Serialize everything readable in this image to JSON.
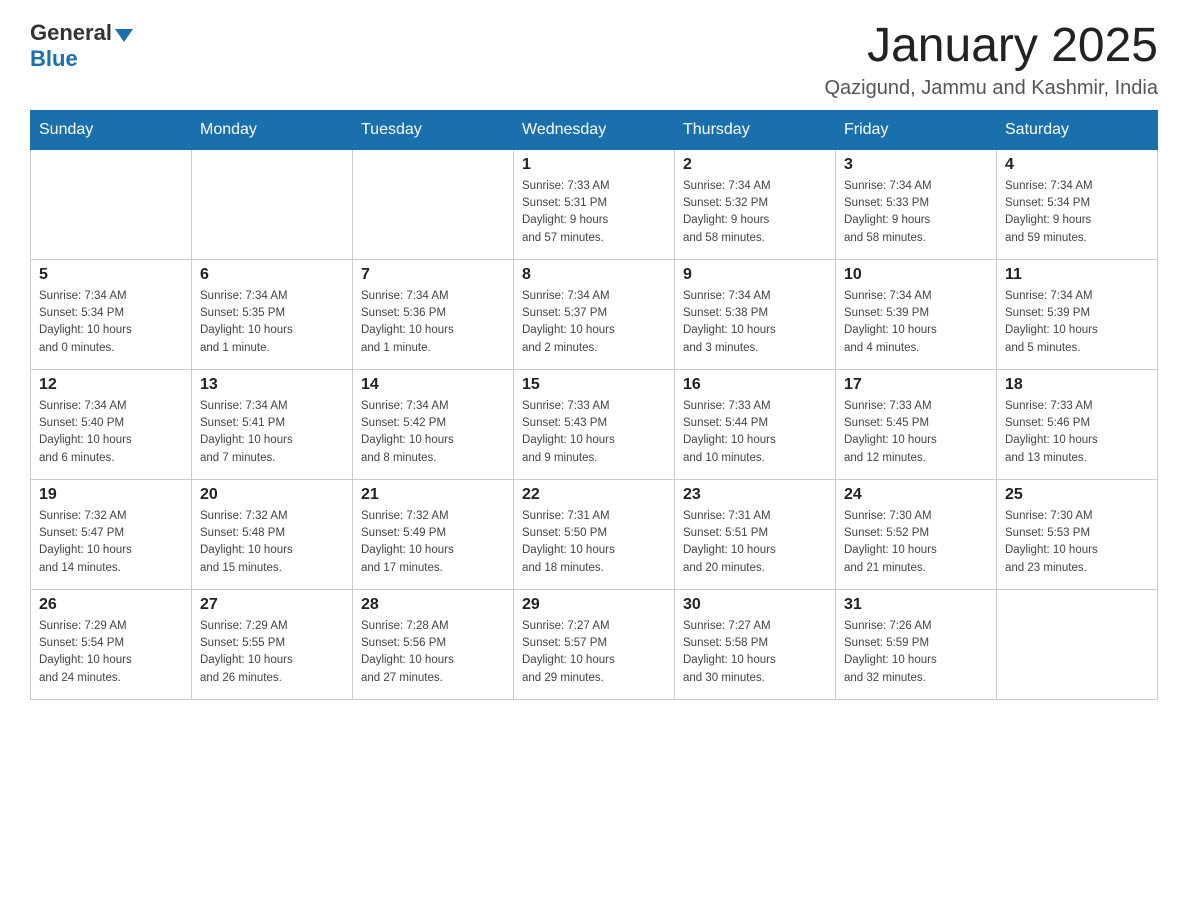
{
  "logo": {
    "general": "General",
    "blue": "Blue"
  },
  "title": {
    "month": "January 2025",
    "location": "Qazigund, Jammu and Kashmir, India"
  },
  "headers": [
    "Sunday",
    "Monday",
    "Tuesday",
    "Wednesday",
    "Thursday",
    "Friday",
    "Saturday"
  ],
  "weeks": [
    [
      {
        "day": "",
        "info": ""
      },
      {
        "day": "",
        "info": ""
      },
      {
        "day": "",
        "info": ""
      },
      {
        "day": "1",
        "info": "Sunrise: 7:33 AM\nSunset: 5:31 PM\nDaylight: 9 hours\nand 57 minutes."
      },
      {
        "day": "2",
        "info": "Sunrise: 7:34 AM\nSunset: 5:32 PM\nDaylight: 9 hours\nand 58 minutes."
      },
      {
        "day": "3",
        "info": "Sunrise: 7:34 AM\nSunset: 5:33 PM\nDaylight: 9 hours\nand 58 minutes."
      },
      {
        "day": "4",
        "info": "Sunrise: 7:34 AM\nSunset: 5:34 PM\nDaylight: 9 hours\nand 59 minutes."
      }
    ],
    [
      {
        "day": "5",
        "info": "Sunrise: 7:34 AM\nSunset: 5:34 PM\nDaylight: 10 hours\nand 0 minutes."
      },
      {
        "day": "6",
        "info": "Sunrise: 7:34 AM\nSunset: 5:35 PM\nDaylight: 10 hours\nand 1 minute."
      },
      {
        "day": "7",
        "info": "Sunrise: 7:34 AM\nSunset: 5:36 PM\nDaylight: 10 hours\nand 1 minute."
      },
      {
        "day": "8",
        "info": "Sunrise: 7:34 AM\nSunset: 5:37 PM\nDaylight: 10 hours\nand 2 minutes."
      },
      {
        "day": "9",
        "info": "Sunrise: 7:34 AM\nSunset: 5:38 PM\nDaylight: 10 hours\nand 3 minutes."
      },
      {
        "day": "10",
        "info": "Sunrise: 7:34 AM\nSunset: 5:39 PM\nDaylight: 10 hours\nand 4 minutes."
      },
      {
        "day": "11",
        "info": "Sunrise: 7:34 AM\nSunset: 5:39 PM\nDaylight: 10 hours\nand 5 minutes."
      }
    ],
    [
      {
        "day": "12",
        "info": "Sunrise: 7:34 AM\nSunset: 5:40 PM\nDaylight: 10 hours\nand 6 minutes."
      },
      {
        "day": "13",
        "info": "Sunrise: 7:34 AM\nSunset: 5:41 PM\nDaylight: 10 hours\nand 7 minutes."
      },
      {
        "day": "14",
        "info": "Sunrise: 7:34 AM\nSunset: 5:42 PM\nDaylight: 10 hours\nand 8 minutes."
      },
      {
        "day": "15",
        "info": "Sunrise: 7:33 AM\nSunset: 5:43 PM\nDaylight: 10 hours\nand 9 minutes."
      },
      {
        "day": "16",
        "info": "Sunrise: 7:33 AM\nSunset: 5:44 PM\nDaylight: 10 hours\nand 10 minutes."
      },
      {
        "day": "17",
        "info": "Sunrise: 7:33 AM\nSunset: 5:45 PM\nDaylight: 10 hours\nand 12 minutes."
      },
      {
        "day": "18",
        "info": "Sunrise: 7:33 AM\nSunset: 5:46 PM\nDaylight: 10 hours\nand 13 minutes."
      }
    ],
    [
      {
        "day": "19",
        "info": "Sunrise: 7:32 AM\nSunset: 5:47 PM\nDaylight: 10 hours\nand 14 minutes."
      },
      {
        "day": "20",
        "info": "Sunrise: 7:32 AM\nSunset: 5:48 PM\nDaylight: 10 hours\nand 15 minutes."
      },
      {
        "day": "21",
        "info": "Sunrise: 7:32 AM\nSunset: 5:49 PM\nDaylight: 10 hours\nand 17 minutes."
      },
      {
        "day": "22",
        "info": "Sunrise: 7:31 AM\nSunset: 5:50 PM\nDaylight: 10 hours\nand 18 minutes."
      },
      {
        "day": "23",
        "info": "Sunrise: 7:31 AM\nSunset: 5:51 PM\nDaylight: 10 hours\nand 20 minutes."
      },
      {
        "day": "24",
        "info": "Sunrise: 7:30 AM\nSunset: 5:52 PM\nDaylight: 10 hours\nand 21 minutes."
      },
      {
        "day": "25",
        "info": "Sunrise: 7:30 AM\nSunset: 5:53 PM\nDaylight: 10 hours\nand 23 minutes."
      }
    ],
    [
      {
        "day": "26",
        "info": "Sunrise: 7:29 AM\nSunset: 5:54 PM\nDaylight: 10 hours\nand 24 minutes."
      },
      {
        "day": "27",
        "info": "Sunrise: 7:29 AM\nSunset: 5:55 PM\nDaylight: 10 hours\nand 26 minutes."
      },
      {
        "day": "28",
        "info": "Sunrise: 7:28 AM\nSunset: 5:56 PM\nDaylight: 10 hours\nand 27 minutes."
      },
      {
        "day": "29",
        "info": "Sunrise: 7:27 AM\nSunset: 5:57 PM\nDaylight: 10 hours\nand 29 minutes."
      },
      {
        "day": "30",
        "info": "Sunrise: 7:27 AM\nSunset: 5:58 PM\nDaylight: 10 hours\nand 30 minutes."
      },
      {
        "day": "31",
        "info": "Sunrise: 7:26 AM\nSunset: 5:59 PM\nDaylight: 10 hours\nand 32 minutes."
      },
      {
        "day": "",
        "info": ""
      }
    ]
  ]
}
